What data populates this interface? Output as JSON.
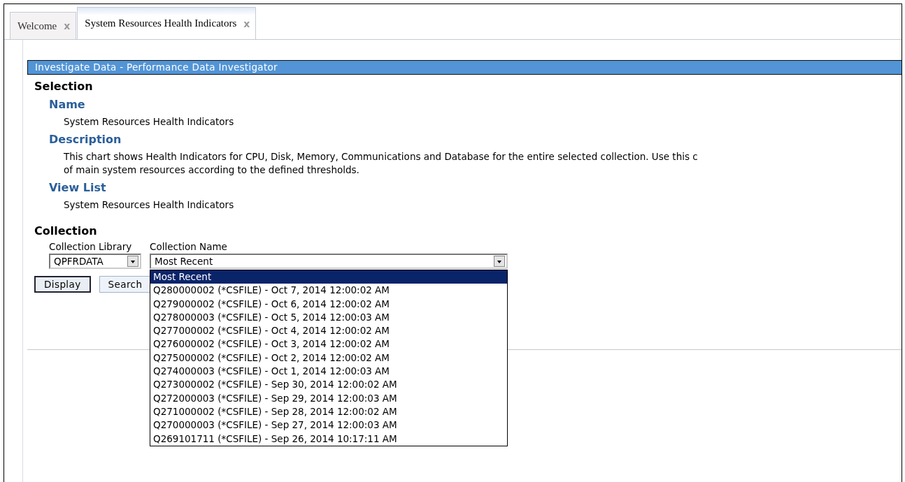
{
  "tabs": [
    {
      "label": "Welcome",
      "selected": false,
      "close": "x"
    },
    {
      "label": "System Resources Health Indicators",
      "selected": true,
      "close": "x"
    }
  ],
  "panel": {
    "title": "Investigate Data - Performance Data Investigator",
    "selection": {
      "heading": "Selection",
      "fields": [
        {
          "label": "Name",
          "lines": [
            "System Resources Health Indicators"
          ]
        },
        {
          "label": "Description",
          "lines": [
            "This chart shows Health Indicators for CPU, Disk, Memory, Communications and Database for the entire selected collection. Use this c",
            "of main system resources according to the defined thresholds."
          ]
        },
        {
          "label": "View List",
          "lines": [
            "System Resources Health Indicators"
          ]
        }
      ]
    },
    "collection": {
      "heading": "Collection",
      "library": {
        "label": "Collection Library",
        "value": "QPFRDATA"
      },
      "name": {
        "label": "Collection Name",
        "value": "Most Recent",
        "options": [
          {
            "label": "Most Recent",
            "selected": true
          },
          {
            "label": "Q280000002 (*CSFILE) - Oct 7, 2014 12:00:02 AM",
            "selected": false
          },
          {
            "label": "Q279000002 (*CSFILE) - Oct 6, 2014 12:00:02 AM",
            "selected": false
          },
          {
            "label": "Q278000003 (*CSFILE) - Oct 5, 2014 12:00:03 AM",
            "selected": false
          },
          {
            "label": "Q277000002 (*CSFILE) - Oct 4, 2014 12:00:02 AM",
            "selected": false
          },
          {
            "label": "Q276000002 (*CSFILE) - Oct 3, 2014 12:00:02 AM",
            "selected": false
          },
          {
            "label": "Q275000002 (*CSFILE) - Oct 2, 2014 12:00:02 AM",
            "selected": false
          },
          {
            "label": "Q274000003 (*CSFILE) - Oct 1, 2014 12:00:03 AM",
            "selected": false
          },
          {
            "label": "Q273000002 (*CSFILE) - Sep 30, 2014 12:00:02 AM",
            "selected": false
          },
          {
            "label": "Q272000003 (*CSFILE) - Sep 29, 2014 12:00:03 AM",
            "selected": false
          },
          {
            "label": "Q271000002 (*CSFILE) - Sep 28, 2014 12:00:02 AM",
            "selected": false
          },
          {
            "label": "Q270000003 (*CSFILE) - Sep 27, 2014 12:00:03 AM",
            "selected": false
          },
          {
            "label": "Q269101711 (*CSFILE) - Sep 26, 2014 10:17:11 AM",
            "selected": false
          }
        ]
      }
    },
    "buttons": [
      {
        "label": "Display",
        "default": true
      },
      {
        "label": "Search",
        "default": false
      }
    ]
  }
}
